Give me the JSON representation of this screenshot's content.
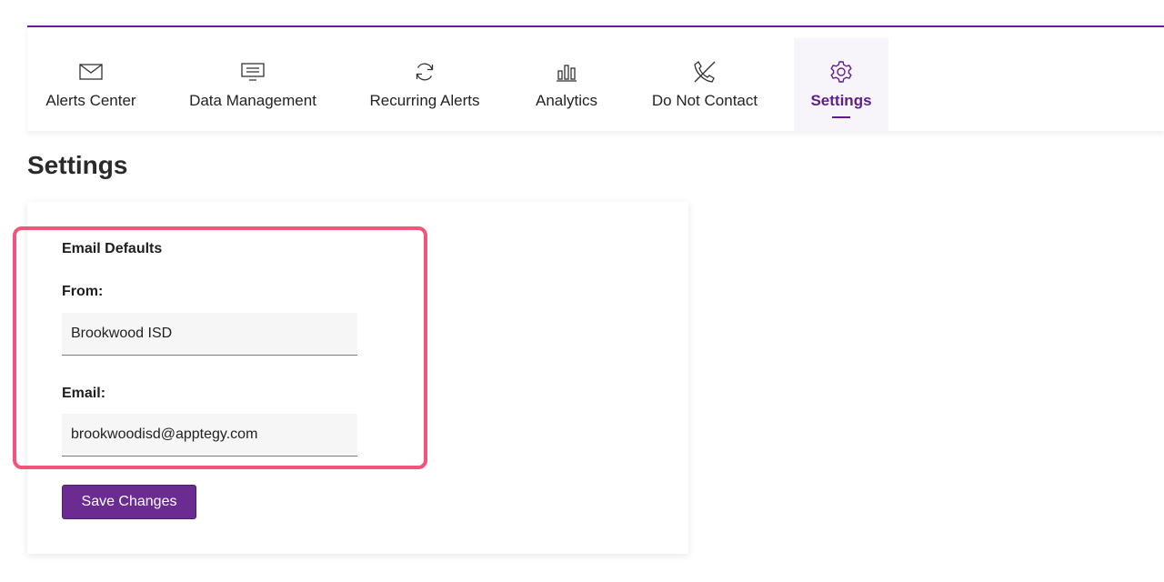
{
  "nav": {
    "tabs": [
      {
        "label": "Alerts Center",
        "icon": "envelope-icon"
      },
      {
        "label": "Data Management",
        "icon": "monitor-icon"
      },
      {
        "label": "Recurring Alerts",
        "icon": "refresh-icon"
      },
      {
        "label": "Analytics",
        "icon": "bar-chart-icon"
      },
      {
        "label": "Do Not Contact",
        "icon": "phone-off-icon"
      },
      {
        "label": "Settings",
        "icon": "gear-icon",
        "active": true
      }
    ],
    "accent_color": "#5f1f8a"
  },
  "page": {
    "title": "Settings"
  },
  "email_defaults": {
    "heading": "Email Defaults",
    "from_label": "From:",
    "from_value": "Brookwood ISD",
    "email_label": "Email:",
    "email_value": "brookwoodisd@apptegy.com"
  },
  "actions": {
    "save_label": "Save Changes",
    "button_color": "#6b2c91"
  },
  "highlight_color": "#f2547a"
}
